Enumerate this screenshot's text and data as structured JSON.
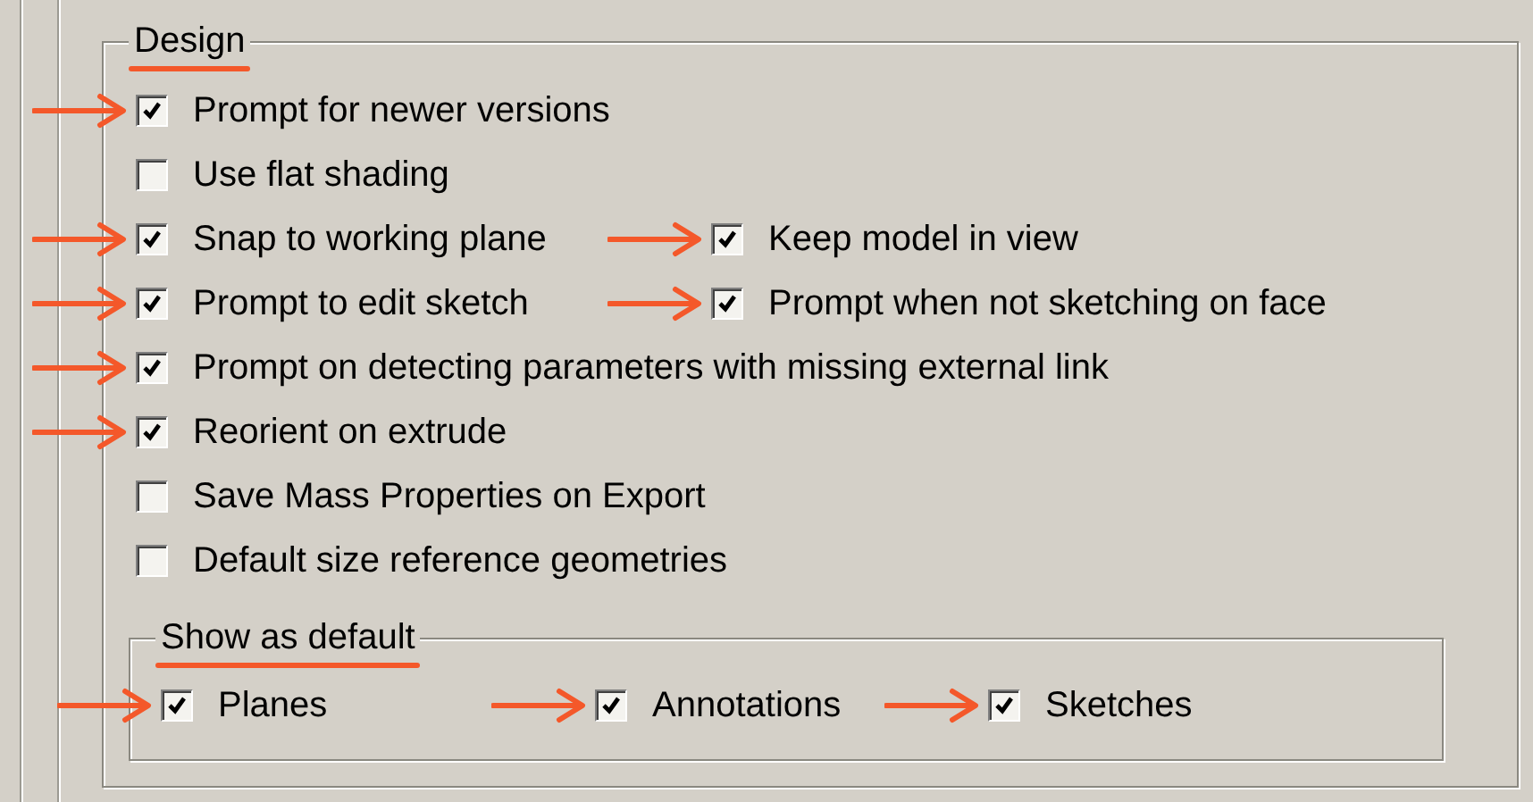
{
  "design": {
    "title": "Design",
    "title_underlined": true,
    "rows": [
      [
        {
          "label": "Prompt for newer versions",
          "checked": true,
          "marked": true
        }
      ],
      [
        {
          "label": "Use flat shading",
          "checked": false,
          "marked": false
        }
      ],
      [
        {
          "label": "Snap to working plane",
          "checked": true,
          "marked": true
        },
        {
          "label": "Keep model in view",
          "checked": true,
          "marked": true
        }
      ],
      [
        {
          "label": "Prompt to edit sketch",
          "checked": true,
          "marked": true
        },
        {
          "label": "Prompt when not sketching on face",
          "checked": true,
          "marked": true
        }
      ],
      [
        {
          "label": "Prompt on detecting parameters with missing external link",
          "checked": true,
          "marked": true
        }
      ],
      [
        {
          "label": "Reorient on extrude",
          "checked": true,
          "marked": true
        }
      ],
      [
        {
          "label": "Save Mass Properties on Export",
          "checked": false,
          "marked": false
        }
      ],
      [
        {
          "label": "Default size reference geometries",
          "checked": false,
          "marked": false
        }
      ]
    ],
    "show_as_default": {
      "title": "Show as default",
      "title_underlined": true,
      "items": [
        {
          "label": "Planes",
          "checked": true,
          "marked": true
        },
        {
          "label": "Annotations",
          "checked": true,
          "marked": true
        },
        {
          "label": "Sketches",
          "checked": true,
          "marked": true
        }
      ]
    }
  }
}
